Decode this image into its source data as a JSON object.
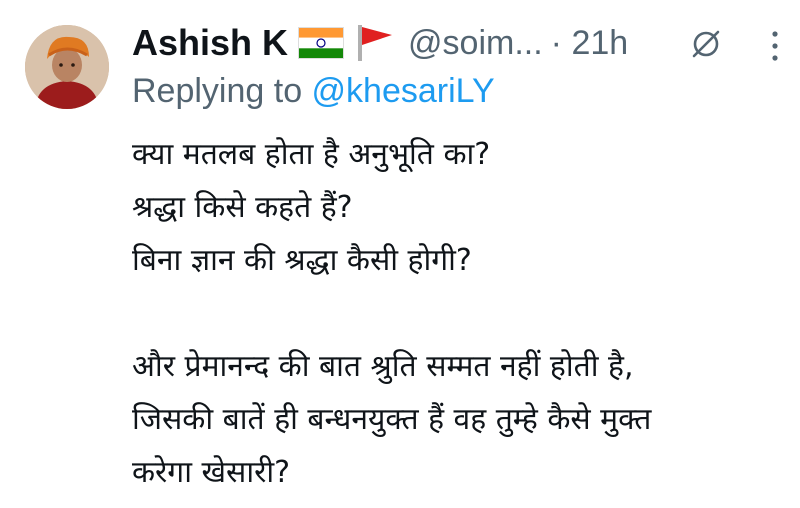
{
  "author": {
    "name": "Ashish K",
    "handle": "@soim...",
    "time": "21h",
    "flags": [
      "india-flag-icon",
      "saffron-flag-icon"
    ]
  },
  "reply": {
    "prefix": "Replying to ",
    "mention": "@khesariLY"
  },
  "body": {
    "line1": "क्या मतलब होता है अनुभूति का?",
    "line2": "श्रद्धा किसे कहते हैं?",
    "line3": "बिना ज्ञान की श्रद्धा कैसी होगी?",
    "line4": "और प्रेमानन्द की बात श्रुति सम्मत नहीं होती है,",
    "line5": "जिसकी बातें ही बन्धनयुक्त हैं वह तुम्हे कैसे मुक्त",
    "line6": "करेगा खेसारी?"
  },
  "colors": {
    "text": "#0f1419",
    "secondary": "#536471",
    "link": "#1d9bf0",
    "saffron": "#ff9933",
    "india_green": "#138808",
    "red_flag": "#e02020"
  },
  "icons": {
    "grok": "grok-icon",
    "more": "more-options-icon"
  }
}
